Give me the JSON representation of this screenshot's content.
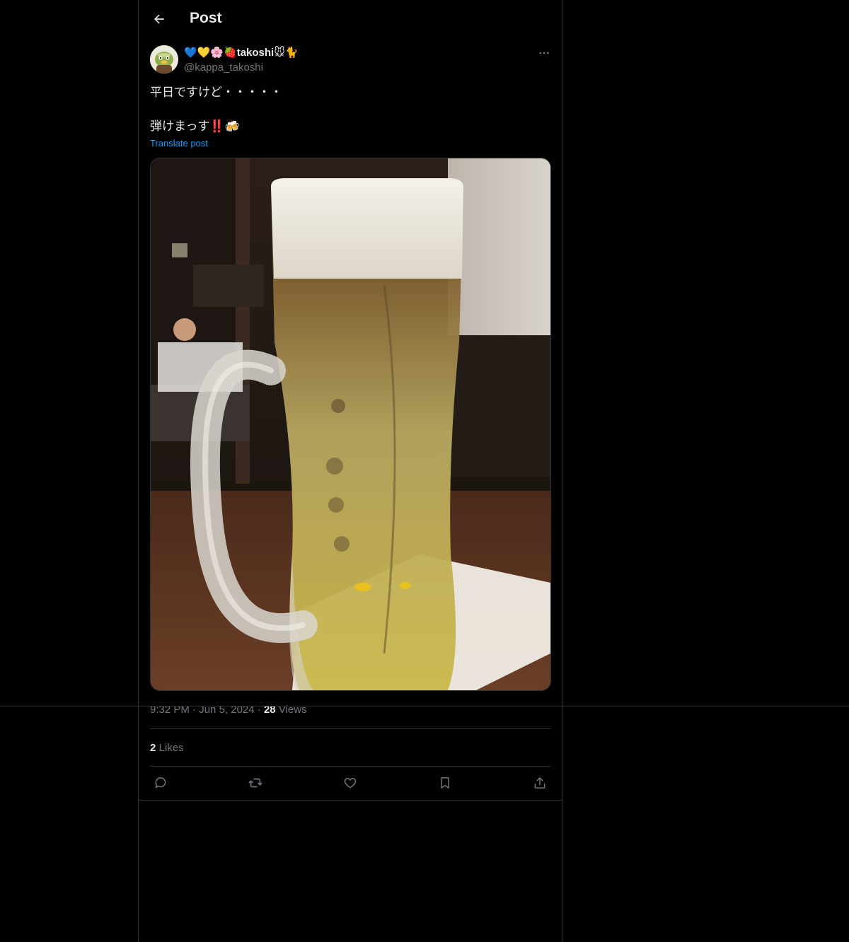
{
  "header": {
    "title": "Post",
    "back_icon": "arrow-left-icon"
  },
  "author": {
    "display_name": "💙💛🌸🍓takoshi🐭🐈",
    "handle": "@kappa_takoshi",
    "avatar_icon": "kappa-avatar"
  },
  "post": {
    "text": "平日ですけど・・・・・\n\n弾けまっす‼️🍻",
    "translate_label": "Translate post",
    "media_alt": "beer-mug-photo"
  },
  "meta": {
    "time": "9:32 PM",
    "date": "Jun 5, 2024",
    "views_count": "28",
    "views_label": "Views"
  },
  "stats": {
    "likes_count": "2",
    "likes_label": "Likes"
  },
  "actions": [
    "reply-icon",
    "repost-icon",
    "like-icon",
    "bookmark-icon",
    "share-icon"
  ],
  "colors": {
    "background": "#000000",
    "text": "#e7e9ea",
    "secondary": "#71767b",
    "link": "#1d9bf0",
    "border": "#2f3336"
  }
}
